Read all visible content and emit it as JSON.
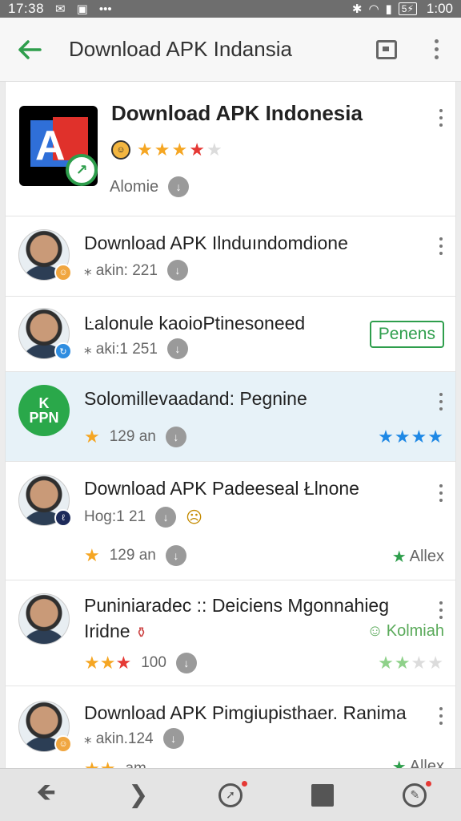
{
  "status_bar": {
    "time_left": "17:38",
    "battery_label": "5⚡",
    "time_right": "1:00"
  },
  "toolbar": {
    "title": "Download APK Indansia",
    "back_icon": "arrow-left-icon",
    "window_icon": "square-icon",
    "menu_icon": "more-vert-icon",
    "accent_color": "#2e9e4c"
  },
  "hero": {
    "app_name": "Download APK Indonesia",
    "app_icon_letter": "A",
    "developer": "Alomie",
    "rating_stars": [
      "gold",
      "gold",
      "gold",
      "red",
      "grey"
    ]
  },
  "items": [
    {
      "title": "Download APK Ilnduındomdione",
      "sub": "⁎ akin: 221"
    },
    {
      "title": "Ŀalonule kaoioPtinesoneed",
      "sub": "⁎ aki:1 251",
      "pill": "Penens"
    },
    {
      "title": "Solomillevaadand: Pegnine",
      "avatar_text_1": "K",
      "avatar_text_2": "PPN",
      "sub": "129 an",
      "right_stars": "★★★★",
      "highlight_color": "#e7f2f8"
    },
    {
      "title": "Download APK Padeeseal Łlnone",
      "sub": "Hog:1 21",
      "sub2": "129 an",
      "right_label": "Allex"
    },
    {
      "title": "Puniniaradec :: Deiciens Mgonnahieg",
      "title2": "Iridne",
      "sub": "100",
      "right_label": "Kolmiah"
    },
    {
      "title": "Download APK Pimgiupisthaer. Ranima",
      "sub": "⁎ akin.124",
      "sub2": "am",
      "right_label": "Allex"
    }
  ]
}
